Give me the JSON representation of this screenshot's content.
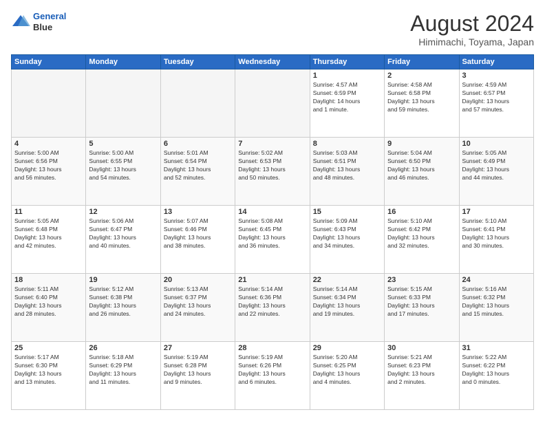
{
  "header": {
    "logo_line1": "General",
    "logo_line2": "Blue",
    "month_year": "August 2024",
    "location": "Himimachi, Toyama, Japan"
  },
  "weekdays": [
    "Sunday",
    "Monday",
    "Tuesday",
    "Wednesday",
    "Thursday",
    "Friday",
    "Saturday"
  ],
  "weeks": [
    [
      {
        "day": "",
        "info": ""
      },
      {
        "day": "",
        "info": ""
      },
      {
        "day": "",
        "info": ""
      },
      {
        "day": "",
        "info": ""
      },
      {
        "day": "1",
        "info": "Sunrise: 4:57 AM\nSunset: 6:59 PM\nDaylight: 14 hours\nand 1 minute."
      },
      {
        "day": "2",
        "info": "Sunrise: 4:58 AM\nSunset: 6:58 PM\nDaylight: 13 hours\nand 59 minutes."
      },
      {
        "day": "3",
        "info": "Sunrise: 4:59 AM\nSunset: 6:57 PM\nDaylight: 13 hours\nand 57 minutes."
      }
    ],
    [
      {
        "day": "4",
        "info": "Sunrise: 5:00 AM\nSunset: 6:56 PM\nDaylight: 13 hours\nand 56 minutes."
      },
      {
        "day": "5",
        "info": "Sunrise: 5:00 AM\nSunset: 6:55 PM\nDaylight: 13 hours\nand 54 minutes."
      },
      {
        "day": "6",
        "info": "Sunrise: 5:01 AM\nSunset: 6:54 PM\nDaylight: 13 hours\nand 52 minutes."
      },
      {
        "day": "7",
        "info": "Sunrise: 5:02 AM\nSunset: 6:53 PM\nDaylight: 13 hours\nand 50 minutes."
      },
      {
        "day": "8",
        "info": "Sunrise: 5:03 AM\nSunset: 6:51 PM\nDaylight: 13 hours\nand 48 minutes."
      },
      {
        "day": "9",
        "info": "Sunrise: 5:04 AM\nSunset: 6:50 PM\nDaylight: 13 hours\nand 46 minutes."
      },
      {
        "day": "10",
        "info": "Sunrise: 5:05 AM\nSunset: 6:49 PM\nDaylight: 13 hours\nand 44 minutes."
      }
    ],
    [
      {
        "day": "11",
        "info": "Sunrise: 5:05 AM\nSunset: 6:48 PM\nDaylight: 13 hours\nand 42 minutes."
      },
      {
        "day": "12",
        "info": "Sunrise: 5:06 AM\nSunset: 6:47 PM\nDaylight: 13 hours\nand 40 minutes."
      },
      {
        "day": "13",
        "info": "Sunrise: 5:07 AM\nSunset: 6:46 PM\nDaylight: 13 hours\nand 38 minutes."
      },
      {
        "day": "14",
        "info": "Sunrise: 5:08 AM\nSunset: 6:45 PM\nDaylight: 13 hours\nand 36 minutes."
      },
      {
        "day": "15",
        "info": "Sunrise: 5:09 AM\nSunset: 6:43 PM\nDaylight: 13 hours\nand 34 minutes."
      },
      {
        "day": "16",
        "info": "Sunrise: 5:10 AM\nSunset: 6:42 PM\nDaylight: 13 hours\nand 32 minutes."
      },
      {
        "day": "17",
        "info": "Sunrise: 5:10 AM\nSunset: 6:41 PM\nDaylight: 13 hours\nand 30 minutes."
      }
    ],
    [
      {
        "day": "18",
        "info": "Sunrise: 5:11 AM\nSunset: 6:40 PM\nDaylight: 13 hours\nand 28 minutes."
      },
      {
        "day": "19",
        "info": "Sunrise: 5:12 AM\nSunset: 6:38 PM\nDaylight: 13 hours\nand 26 minutes."
      },
      {
        "day": "20",
        "info": "Sunrise: 5:13 AM\nSunset: 6:37 PM\nDaylight: 13 hours\nand 24 minutes."
      },
      {
        "day": "21",
        "info": "Sunrise: 5:14 AM\nSunset: 6:36 PM\nDaylight: 13 hours\nand 22 minutes."
      },
      {
        "day": "22",
        "info": "Sunrise: 5:14 AM\nSunset: 6:34 PM\nDaylight: 13 hours\nand 19 minutes."
      },
      {
        "day": "23",
        "info": "Sunrise: 5:15 AM\nSunset: 6:33 PM\nDaylight: 13 hours\nand 17 minutes."
      },
      {
        "day": "24",
        "info": "Sunrise: 5:16 AM\nSunset: 6:32 PM\nDaylight: 13 hours\nand 15 minutes."
      }
    ],
    [
      {
        "day": "25",
        "info": "Sunrise: 5:17 AM\nSunset: 6:30 PM\nDaylight: 13 hours\nand 13 minutes."
      },
      {
        "day": "26",
        "info": "Sunrise: 5:18 AM\nSunset: 6:29 PM\nDaylight: 13 hours\nand 11 minutes."
      },
      {
        "day": "27",
        "info": "Sunrise: 5:19 AM\nSunset: 6:28 PM\nDaylight: 13 hours\nand 9 minutes."
      },
      {
        "day": "28",
        "info": "Sunrise: 5:19 AM\nSunset: 6:26 PM\nDaylight: 13 hours\nand 6 minutes."
      },
      {
        "day": "29",
        "info": "Sunrise: 5:20 AM\nSunset: 6:25 PM\nDaylight: 13 hours\nand 4 minutes."
      },
      {
        "day": "30",
        "info": "Sunrise: 5:21 AM\nSunset: 6:23 PM\nDaylight: 13 hours\nand 2 minutes."
      },
      {
        "day": "31",
        "info": "Sunrise: 5:22 AM\nSunset: 6:22 PM\nDaylight: 13 hours\nand 0 minutes."
      }
    ]
  ]
}
